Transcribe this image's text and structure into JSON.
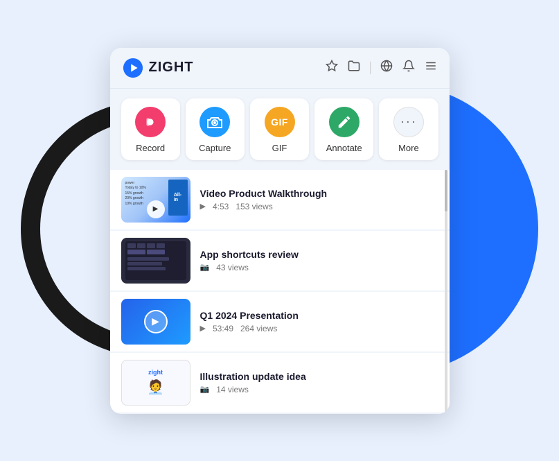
{
  "background": {
    "blue_circle_color": "#1e6fff",
    "outline_circle_color": "#1a1a1a"
  },
  "header": {
    "logo_text": "ZIGHT",
    "icons": [
      "star",
      "folder",
      "globe",
      "bell",
      "menu"
    ]
  },
  "toolbar": {
    "buttons": [
      {
        "id": "record",
        "label": "Record",
        "icon_type": "record",
        "icon_char": "⏺"
      },
      {
        "id": "capture",
        "label": "Capture",
        "icon_type": "capture",
        "icon_char": "📷"
      },
      {
        "id": "gif",
        "label": "GIF",
        "icon_type": "gif",
        "icon_char": "GIF"
      },
      {
        "id": "annotate",
        "label": "Annotate",
        "icon_type": "annotate",
        "icon_char": "✏"
      },
      {
        "id": "more",
        "label": "More",
        "icon_type": "more",
        "icon_char": "···"
      }
    ]
  },
  "list": {
    "items": [
      {
        "id": "item1",
        "title": "Video Product Walkthrough",
        "duration": "4:53",
        "views": "153 views",
        "type": "video",
        "thumb_type": "thumb1"
      },
      {
        "id": "item2",
        "title": "App shortcuts review",
        "views": "43 views",
        "type": "screenshot",
        "thumb_type": "thumb2",
        "has_actions": true
      },
      {
        "id": "item3",
        "title": "Q1 2024 Presentation",
        "duration": "53:49",
        "views": "264 views",
        "type": "video",
        "thumb_type": "thumb3"
      },
      {
        "id": "item4",
        "title": "Illustration update idea",
        "views": "14 views",
        "type": "screenshot",
        "thumb_type": "thumb4"
      }
    ]
  }
}
